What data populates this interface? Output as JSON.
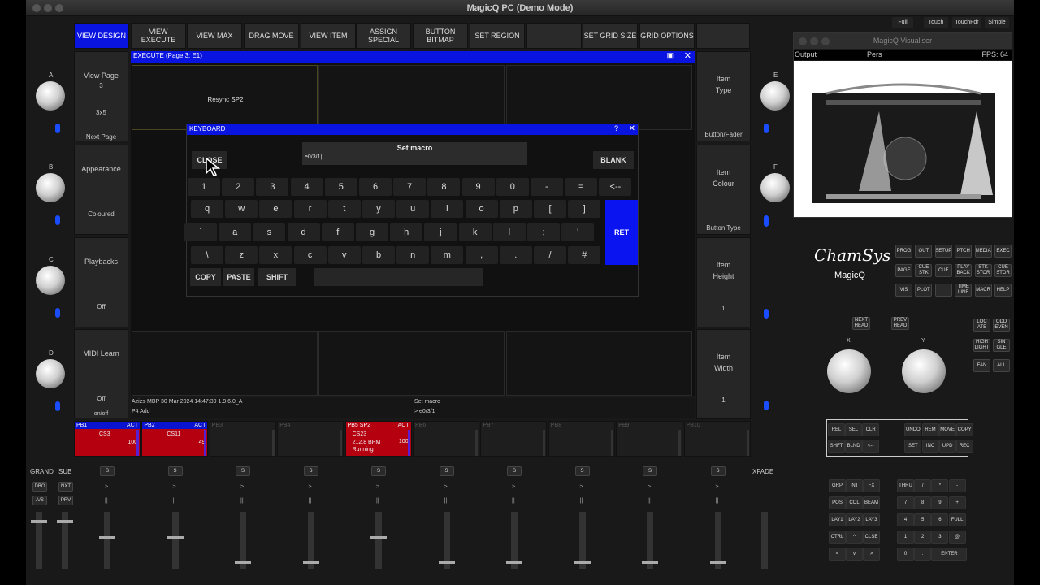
{
  "window": {
    "title": "MagicQ PC (Demo Mode)"
  },
  "toolbar": [
    "VIEW DESIGN",
    "VIEW EXECUTE",
    "VIEW MAX",
    "DRAG MOVE",
    "VIEW ITEM",
    "ASSIGN SPECIAL",
    "BUTTON BITMAP",
    "SET REGION",
    "",
    "SET GRID SIZE",
    "GRID OPTIONS",
    ""
  ],
  "view_buttons": [
    "Full",
    "Touch",
    "TouchFdr",
    "Simple"
  ],
  "left_panels": [
    {
      "top": "View Page",
      "mid": "3",
      "mid2": "3x5",
      "bottom": "Next Page"
    },
    {
      "top": "Appearance",
      "bottom": "Coloured"
    },
    {
      "top": "Playbacks",
      "bottom": "Off"
    },
    {
      "top": "MIDI Learn",
      "bottom": "Off",
      "extra": "on/off"
    }
  ],
  "right_panels": [
    {
      "top": "Item",
      "top2": "Type",
      "bottom": "Button/Fader"
    },
    {
      "top": "Item",
      "top2": "Colour",
      "bottom": "Button Type"
    },
    {
      "top": "Item",
      "top2": "Height",
      "bottom": "1"
    },
    {
      "top": "Item",
      "top2": "Width",
      "bottom": "1"
    }
  ],
  "encoder_labels": [
    "A",
    "B",
    "C",
    "D",
    "E",
    "F",
    "X",
    "Y"
  ],
  "execute": {
    "title": "EXECUTE (Page 3: E1)",
    "cell1": "Resync SP2"
  },
  "keyboard": {
    "title": "KEYBOARD",
    "help": "?",
    "close_x": "✕",
    "close": "CLOSE",
    "prompt": "Set macro",
    "value": "e0/3/1|",
    "blank": "BLANK",
    "ret": "RET",
    "row1": [
      "1",
      "2",
      "3",
      "4",
      "5",
      "6",
      "7",
      "8",
      "9",
      "0",
      "-",
      "=",
      "<--"
    ],
    "row2": [
      "q",
      "w",
      "e",
      "r",
      "t",
      "y",
      "u",
      "i",
      "o",
      "p",
      "[",
      "]"
    ],
    "row3": [
      "`",
      "a",
      "s",
      "d",
      "f",
      "g",
      "h",
      "j",
      "k",
      "l",
      ";",
      "'"
    ],
    "row4": [
      "\\",
      "z",
      "x",
      "c",
      "v",
      "b",
      "n",
      "m",
      ",",
      ".",
      "/",
      "#"
    ],
    "copy": "COPY",
    "paste": "PASTE",
    "shift": "SHIFT"
  },
  "status": {
    "left1": "Azizs-MBP 30 Mar 2024 14:47:39 1.9.6.0_A",
    "left2": "P4  Add",
    "right1": "Set macro",
    "right2": "> e0/3/1"
  },
  "playbacks": [
    {
      "name": "PB1",
      "act": "ACT",
      "cue": "CS3",
      "val": "100",
      "active": true
    },
    {
      "name": "PB2",
      "act": "ACT",
      "cue": "CS11",
      "val": "49",
      "active": true
    },
    {
      "name": "PB3",
      "act": "",
      "cue": "",
      "val": "",
      "active": false
    },
    {
      "name": "PB4",
      "act": "",
      "cue": "",
      "val": "",
      "active": false
    },
    {
      "name": "PB5 SP2",
      "act": "ACT",
      "cue": "CS23",
      "val": "100",
      "bpm": "212.8 BPM",
      "state": "Running",
      "active": true
    },
    {
      "name": "PB6",
      "act": "",
      "cue": "",
      "val": "",
      "active": false
    },
    {
      "name": "PB7",
      "act": "",
      "cue": "",
      "val": "",
      "active": false
    },
    {
      "name": "PB8",
      "act": "",
      "cue": "",
      "val": "",
      "active": false
    },
    {
      "name": "PB9",
      "act": "",
      "cue": "",
      "val": "",
      "active": false
    },
    {
      "name": "PB10",
      "act": "",
      "cue": "",
      "val": "",
      "active": false
    }
  ],
  "fader_section": {
    "grand": "GRAND",
    "sub": "SUB",
    "xfade": "XFADE",
    "dbo": "DBO",
    "nxt": "NXT",
    "as": "A/S",
    "prv": "PRV",
    "s": "S"
  },
  "visualiser": {
    "title": "MagicQ Visualiser",
    "output": "Output",
    "pers": "Pers",
    "fps": "FPS: 64"
  },
  "brand": {
    "logo": "ChamSys",
    "sub": "MagicQ"
  },
  "console_grid1": [
    "PROG",
    "OUT",
    "SETUP",
    "PTCH",
    "MEDIA",
    "EXEC",
    "PAGE",
    "CUE STK",
    "CUE",
    "PLAY BACK",
    "STK STOR",
    "CUE STOR",
    "VIS",
    "PLOT",
    "",
    "TIME LINE",
    "MACR",
    "HELP"
  ],
  "head_buttons": [
    "NEXT HEAD",
    "PREV HEAD"
  ],
  "right_col": [
    "LOC ATE",
    "ODD EVEN",
    "HIGH LIGHT",
    "SIN GLE",
    "FAN",
    "ALL"
  ],
  "edit_grid": [
    "REL",
    "SEL",
    "CLR",
    "",
    "UNDO",
    "REM",
    "MOVE",
    "COPY",
    "SHFT",
    "BLND",
    "<--",
    "",
    "SET",
    "INC",
    "UPD",
    "REC"
  ],
  "sel_grid": [
    "GRP",
    "INT",
    "FX",
    "POS",
    "COL",
    "BEAM",
    "LAY1",
    "LAY2",
    "LAY3",
    "CTRL",
    "^",
    "CLSE",
    "<",
    "v",
    ">"
  ],
  "keypad": [
    "THRU",
    "/",
    "*",
    "-",
    "7",
    "8",
    "9",
    "+",
    "4",
    "5",
    "6",
    "FULL",
    "1",
    "2",
    "3",
    "@",
    "0",
    ".",
    "ENTER"
  ]
}
